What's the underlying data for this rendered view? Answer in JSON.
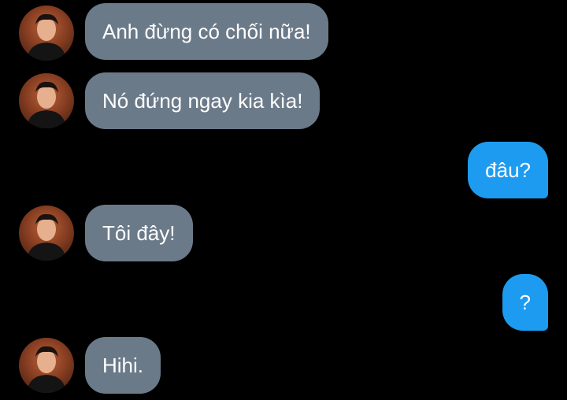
{
  "conversation": {
    "messages": [
      {
        "side": "in",
        "text": "Anh đừng có chối nữa!"
      },
      {
        "side": "in",
        "text": "Nó đứng ngay kia kìa!"
      },
      {
        "side": "out",
        "text": "đâu?"
      },
      {
        "side": "in",
        "text": "Tôi đây!"
      },
      {
        "side": "out",
        "text": "?"
      },
      {
        "side": "in",
        "text": "Hihi."
      }
    ]
  },
  "colors": {
    "background": "#000000",
    "incoming_bubble": "#6b7a89",
    "outgoing_bubble": "#1d9bf0",
    "text": "#ffffff"
  }
}
